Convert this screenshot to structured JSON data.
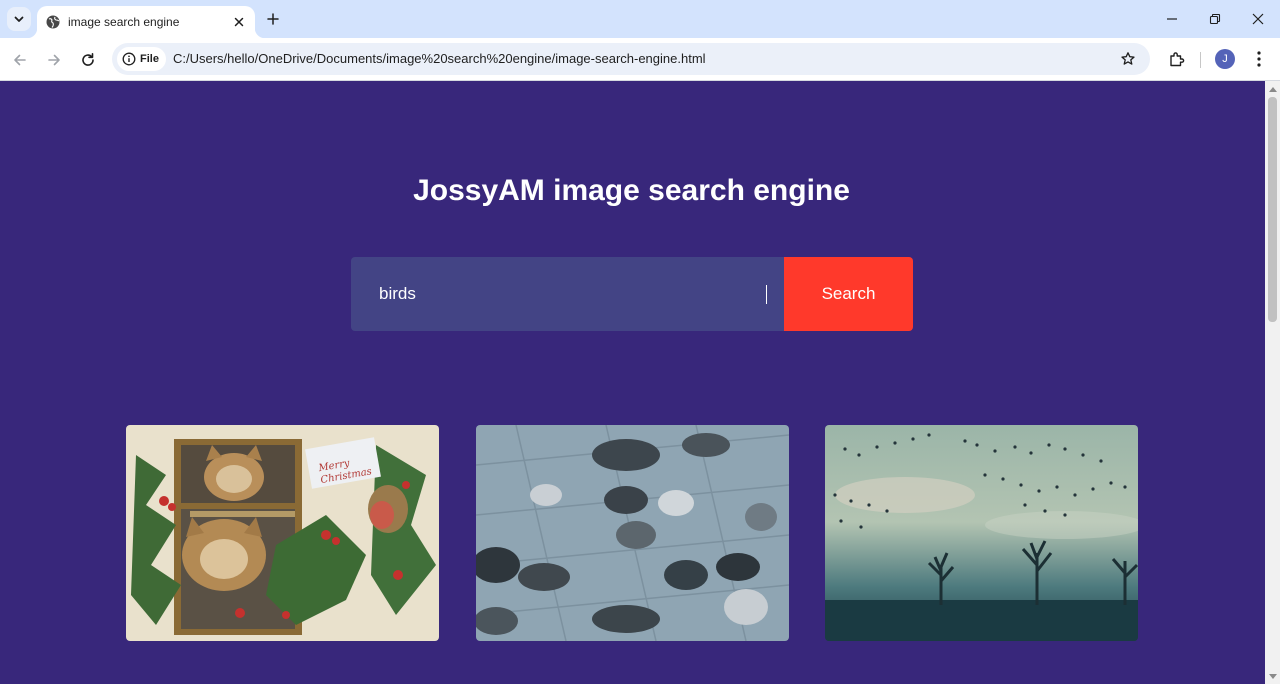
{
  "browser": {
    "tab": {
      "title": "image search engine",
      "favicon": "globe-icon"
    },
    "new_tab_icon": "plus-icon",
    "address": {
      "chip_label": "File",
      "url": "C:/Users/hello/OneDrive/Documents/image%20search%20engine/image-search-engine.html"
    },
    "profile_initial": "J"
  },
  "page": {
    "heading": "JossyAM image search engine",
    "search": {
      "value": "birds",
      "button_label": "Search"
    },
    "results": [
      {
        "subject": "vintage christmas postcard with kittens, holly and robin",
        "card_text_line1": "Merry",
        "card_text_line2": "Christmas"
      },
      {
        "subject": "pigeons on paved square"
      },
      {
        "subject": "flock of birds over misty trees"
      }
    ]
  },
  "colors": {
    "page_background": "#38277b",
    "input_background": "#434485",
    "search_button": "#ff392b",
    "tabstrip": "#d3e3fd"
  }
}
